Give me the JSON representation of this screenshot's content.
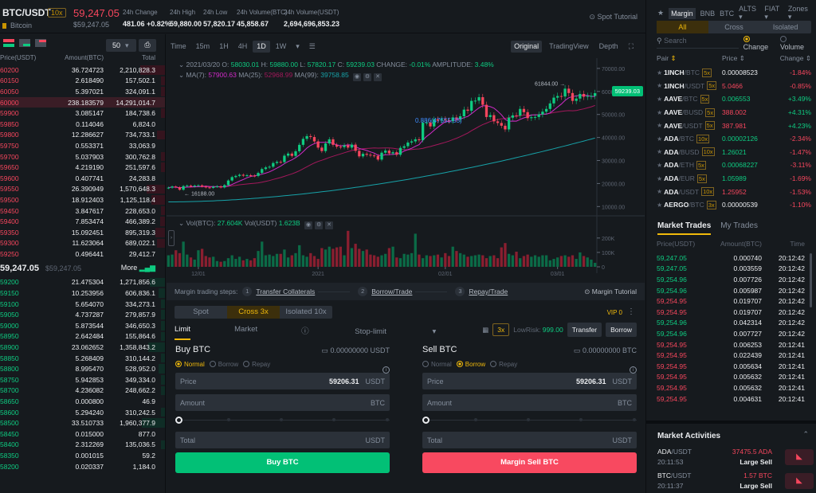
{
  "header": {
    "pair": "BTC/USDT",
    "leverage": "10x",
    "coin_name": "Bitcoin",
    "last_price": "59,247.05",
    "last_price_usd": "$59,247.05",
    "stats": [
      {
        "label": "24h Change",
        "value": "481.06 +0.82%",
        "color": "green"
      },
      {
        "label": "24h High",
        "value": "59,880.00"
      },
      {
        "label": "24h Low",
        "value": "57,820.17"
      },
      {
        "label": "24h Volume(BTC)",
        "value": "45,858.67"
      },
      {
        "label": "24h Volume(USDT)",
        "value": "2,694,696,853.23"
      }
    ],
    "spot_tutorial": "Spot Tutorial"
  },
  "orderbook": {
    "depth_select": "50",
    "columns": [
      "Price(USDT)",
      "Amount(BTC)",
      "Total"
    ],
    "asks": [
      {
        "price": "60200",
        "amount": "36.724723",
        "total": "2,210,828.3",
        "depth": 0.15
      },
      {
        "price": "60150",
        "amount": "2.618490",
        "total": "157,502.1",
        "depth": 0.01
      },
      {
        "price": "60050",
        "amount": "5.397021",
        "total": "324,091.1",
        "depth": 0.02
      },
      {
        "price": "60000",
        "amount": "238.183579",
        "total": "14,291,014.7",
        "depth": 1.0,
        "highlight": true
      },
      {
        "price": "59900",
        "amount": "3.085147",
        "total": "184,738.6",
        "depth": 0.01
      },
      {
        "price": "59850",
        "amount": "0.114046",
        "total": "6,824.0",
        "depth": 0.0
      },
      {
        "price": "59800",
        "amount": "12.286627",
        "total": "734,733.1",
        "depth": 0.05
      },
      {
        "price": "59750",
        "amount": "0.553371",
        "total": "33,063.9",
        "depth": 0.0
      },
      {
        "price": "59700",
        "amount": "5.037903",
        "total": "300,762.8",
        "depth": 0.02
      },
      {
        "price": "59650",
        "amount": "4.219190",
        "total": "251,597.6",
        "depth": 0.02
      },
      {
        "price": "59600",
        "amount": "0.407741",
        "total": "24,283.8",
        "depth": 0.0
      },
      {
        "price": "59550",
        "amount": "26.390949",
        "total": "1,570,648.3",
        "depth": 0.11
      },
      {
        "price": "59500",
        "amount": "18.912403",
        "total": "1,125,118.4",
        "depth": 0.08
      },
      {
        "price": "59450",
        "amount": "3.847617",
        "total": "228,653.0",
        "depth": 0.02
      },
      {
        "price": "59400",
        "amount": "7.853474",
        "total": "466,389.2",
        "depth": 0.03
      },
      {
        "price": "59350",
        "amount": "15.092451",
        "total": "895,319.3",
        "depth": 0.06
      },
      {
        "price": "59300",
        "amount": "11.623064",
        "total": "689,022.1",
        "depth": 0.05
      },
      {
        "price": "59250",
        "amount": "0.496441",
        "total": "29,412.7",
        "depth": 0.0
      }
    ],
    "mid_price": "59,247.05",
    "mid_price_usd": "$59,247.05",
    "more_label": "More",
    "bids": [
      {
        "price": "59200",
        "amount": "21.475304",
        "total": "1,271,856.6",
        "depth": 0.09
      },
      {
        "price": "59150",
        "amount": "10.253956",
        "total": "606,836.1",
        "depth": 0.04
      },
      {
        "price": "59100",
        "amount": "5.654070",
        "total": "334,273.1",
        "depth": 0.02
      },
      {
        "price": "59050",
        "amount": "4.737287",
        "total": "279,857.9",
        "depth": 0.02
      },
      {
        "price": "59000",
        "amount": "5.873544",
        "total": "346,650.3",
        "depth": 0.02
      },
      {
        "price": "58950",
        "amount": "2.642484",
        "total": "155,864.6",
        "depth": 0.01
      },
      {
        "price": "58900",
        "amount": "23.062652",
        "total": "1,358,843.2",
        "depth": 0.1
      },
      {
        "price": "58850",
        "amount": "5.268409",
        "total": "310,144.2",
        "depth": 0.02
      },
      {
        "price": "58800",
        "amount": "8.995470",
        "total": "528,952.0",
        "depth": 0.04
      },
      {
        "price": "58750",
        "amount": "5.942853",
        "total": "349,334.0",
        "depth": 0.02
      },
      {
        "price": "58700",
        "amount": "4.236082",
        "total": "248,662.2",
        "depth": 0.02
      },
      {
        "price": "58650",
        "amount": "0.000800",
        "total": "46.9",
        "depth": 0.0
      },
      {
        "price": "58600",
        "amount": "5.294240",
        "total": "310,242.5",
        "depth": 0.02
      },
      {
        "price": "58500",
        "amount": "33.510733",
        "total": "1,960,377.9",
        "depth": 0.14
      },
      {
        "price": "58450",
        "amount": "0.015000",
        "total": "877.0",
        "depth": 0.0
      },
      {
        "price": "58400",
        "amount": "2.312269",
        "total": "135,036.5",
        "depth": 0.01
      },
      {
        "price": "58350",
        "amount": "0.001015",
        "total": "59.2",
        "depth": 0.0
      },
      {
        "price": "58200",
        "amount": "0.020337",
        "total": "1,184.0",
        "depth": 0.0
      }
    ]
  },
  "chart": {
    "intervals": [
      "Time",
      "15m",
      "1H",
      "4H",
      "1D",
      "1W"
    ],
    "active_interval": "1D",
    "views": [
      "Original",
      "TradingView",
      "Depth"
    ],
    "active_view": "Original",
    "ohlc": {
      "date": "2021/03/20",
      "o_label": "O:",
      "o": "58030.01",
      "h_label": "H:",
      "h": "59880.00",
      "l_label": "L:",
      "l": "57820.17",
      "c_label": "C:",
      "c": "59239.03",
      "change_label": "CHANGE:",
      "change": "-0.01%",
      "amp_label": "AMPLITUDE:",
      "amp": "3.48%"
    },
    "ma": {
      "ma7_label": "MA(7):",
      "ma7": "57900.63",
      "ma25_label": "MA(25):",
      "ma25": "52968.99",
      "ma99_label": "MA(99):",
      "ma99": "39758.85"
    },
    "vol": {
      "btc_label": "Vol(BTC):",
      "btc": "27.604K",
      "usdt_label": "Vol(USDT)",
      "usdt": "1.623B"
    },
    "current_price_tag": "59239.03",
    "high_marker": "61844.00",
    "low_marker": "16188.00",
    "fib_label": "0.886(47555.55)",
    "colors": {
      "up": "#0ecb81",
      "down": "#f6465d",
      "ma7": "#d12ac8",
      "ma25": "#a3185b",
      "ma99": "#17a2a8"
    }
  },
  "chart_data": {
    "type": "candlestick",
    "title": "BTC/USDT 1D",
    "x_tick_labels": [
      "12/01",
      "2021",
      "02/01",
      "03/01"
    ],
    "y_ticks": [
      10000,
      20000,
      30000,
      40000,
      50000,
      60000,
      70000
    ],
    "y_tick_labels": [
      "10000.00",
      "20000.00",
      "30000.00",
      "40000.00",
      "50000.00",
      "60000.00",
      "70000.00"
    ],
    "ylim": [
      7000,
      71000
    ],
    "vol_ticks": [
      0,
      100000,
      200000
    ],
    "vol_tick_labels": [
      "0",
      "100K",
      "200K"
    ],
    "vol_ylim": [
      0,
      260000
    ],
    "close_series": [
      18200,
      18700,
      18400,
      17300,
      18900,
      19100,
      18700,
      19100,
      19200,
      18700,
      18300,
      18100,
      18600,
      18800,
      18300,
      19300,
      21300,
      22800,
      23300,
      23800,
      23400,
      23600,
      23400,
      23300,
      24600,
      26300,
      27000,
      27300,
      28900,
      29400,
      29300,
      32100,
      33000,
      32000,
      34000,
      36800,
      39400,
      40600,
      40200,
      38300,
      35600,
      34100,
      37400,
      39200,
      36800,
      36000,
      35800,
      36600,
      35600,
      36900,
      34200,
      31800,
      32900,
      32500,
      32200,
      32000,
      30400,
      33400,
      34300,
      33100,
      33600,
      32500,
      35500,
      36200,
      37800,
      38300,
      39200,
      38800,
      46400,
      46500,
      44800,
      47900,
      47300,
      48000,
      47400,
      47100,
      48700,
      47900,
      49200,
      52100,
      51600,
      55900,
      56000,
      57500,
      54200,
      48900,
      49700,
      47000,
      46300,
      45100,
      43500,
      48600,
      49600,
      49500,
      52400,
      51000,
      48400,
      48800,
      48900,
      50000,
      51200,
      52400,
      54800,
      57300,
      58000,
      57800,
      61200,
      59300,
      55900,
      56900,
      58900,
      57700,
      58000,
      58100,
      59239
    ],
    "open_series": [
      18000,
      18200,
      18700,
      18400,
      17300,
      18900,
      19100,
      18700,
      19100,
      19200,
      18700,
      18300,
      18100,
      18600,
      18800,
      18300,
      19300,
      21300,
      22800,
      23300,
      23800,
      23400,
      23600,
      23400,
      23300,
      24600,
      26300,
      27000,
      27300,
      28900,
      29400,
      29300,
      32100,
      33000,
      32000,
      34000,
      36800,
      39400,
      40600,
      40200,
      38300,
      35600,
      34100,
      37400,
      39200,
      36800,
      36000,
      35800,
      36600,
      35600,
      36900,
      34200,
      31800,
      32900,
      32500,
      32200,
      32000,
      30400,
      33400,
      34300,
      33100,
      33600,
      32500,
      35500,
      36200,
      37800,
      38300,
      39200,
      38800,
      46400,
      46500,
      44800,
      47900,
      47300,
      48000,
      47400,
      47100,
      48700,
      47900,
      49200,
      52100,
      51600,
      55900,
      56000,
      57500,
      54200,
      48900,
      49700,
      47000,
      46300,
      45100,
      43500,
      48600,
      49600,
      49500,
      52400,
      51000,
      48400,
      48800,
      48900,
      50000,
      51200,
      52400,
      54800,
      57300,
      58000,
      57800,
      61200,
      59300,
      55900,
      56900,
      58900,
      57700,
      58000,
      58030
    ],
    "volume_series": [
      80000,
      85000,
      115000,
      95000,
      175000,
      85000,
      65000,
      50000,
      115000,
      125000,
      75000,
      65000,
      70000,
      40000,
      35000,
      40000,
      60000,
      80000,
      55000,
      70000,
      45000,
      55000,
      45000,
      60000,
      110000,
      175000,
      80000,
      85000,
      75000,
      90000,
      90000,
      120000,
      65000,
      80000,
      95000,
      150000,
      80000,
      70000,
      95000,
      75000,
      55000,
      130000,
      120000,
      140000,
      125000,
      135000,
      140000,
      80000,
      250000,
      130000,
      160000,
      125000,
      110000,
      120000,
      85000,
      80000,
      70000,
      80000,
      90000,
      130000,
      140000,
      65000,
      60000,
      90000,
      85000,
      95000,
      230000,
      85000,
      60000,
      80000,
      75000,
      80000,
      85000,
      65000,
      95000,
      75000,
      140000,
      110000,
      95000,
      85000,
      70000,
      75000,
      80000,
      85000,
      80000,
      60000,
      75000,
      80000,
      60000,
      135000,
      165000,
      90000,
      80000,
      105000,
      60000,
      75000,
      85000,
      70000,
      80000,
      70000,
      80000,
      80000,
      45000,
      55000,
      65000,
      75000,
      80000,
      70000,
      80000,
      55000,
      100000,
      75000,
      65000,
      50000,
      27604
    ],
    "ma7_note": "MA(7) 57900.63",
    "ma25_note": "MA(25) 52968.99",
    "ma99_note": "MA(99) 39758.85"
  },
  "steps": {
    "label": "Margin trading steps:",
    "items": [
      {
        "num": "1",
        "label": "Transfer Collaterals"
      },
      {
        "num": "2",
        "label": "Borrow/Trade"
      },
      {
        "num": "3",
        "label": "Repay/Trade"
      }
    ],
    "tutorial": "Margin Tutorial"
  },
  "trade": {
    "modes": [
      "Spot",
      "Cross 3x",
      "Isolated 10x"
    ],
    "active_mode": "Cross 3x",
    "vip": "VIP 0",
    "order_types": [
      "Limit",
      "Market",
      "Stop-limit"
    ],
    "leverage": "3x",
    "low_risk_label": "LowRisk:",
    "low_risk_value": "999.00",
    "transfer": "Transfer",
    "borrow": "Borrow",
    "buy": {
      "title": "Buy BTC",
      "balance": "0.00000000 USDT",
      "options": [
        "Normal",
        "Borrow",
        "Repay"
      ],
      "selected": "Normal",
      "price_label": "Price",
      "price_value": "59206.31",
      "price_unit": "USDT",
      "amount_label": "Amount",
      "amount_unit": "BTC",
      "slider_percent": 0,
      "total_label": "Total",
      "total_unit": "USDT",
      "button": "Buy BTC"
    },
    "sell": {
      "title": "Sell BTC",
      "balance": "0.00000000 BTC",
      "options": [
        "Normal",
        "Borrow",
        "Repay"
      ],
      "selected": "Borrow",
      "price_label": "Price",
      "price_value": "59206.31",
      "price_unit": "USDT",
      "amount_label": "Amount",
      "amount_unit": "BTC",
      "slider_percent": 0,
      "total_label": "Total",
      "total_unit": "USDT",
      "button": "Margin Sell BTC"
    }
  },
  "markets": {
    "tabs": [
      "Margin",
      "BNB",
      "BTC",
      "ALTS ▾",
      "FIAT ▾",
      "Zones ▾"
    ],
    "active_tab": "Margin",
    "segments": [
      "All",
      "Cross",
      "Isolated"
    ],
    "active_segment": "All",
    "search_placeholder": "Search",
    "sort_options": [
      "Change",
      "Volume"
    ],
    "selected_sort": "Change",
    "columns": [
      "Pair",
      "Price",
      "Change"
    ],
    "pairs": [
      {
        "base": "1INCH",
        "quote": "/BTC",
        "lev": "5x",
        "price": "0.00008523",
        "price_color": "neutral",
        "change": "-1.84%"
      },
      {
        "base": "1INCH",
        "quote": "/USDT",
        "lev": "5x",
        "price": "5.0466",
        "price_color": "red",
        "change": "-0.85%"
      },
      {
        "base": "AAVE",
        "quote": "/BTC",
        "lev": "5x",
        "price": "0.006553",
        "price_color": "green",
        "change": "+3.49%"
      },
      {
        "base": "AAVE",
        "quote": "/BUSD",
        "lev": "5x",
        "price": "388.002",
        "price_color": "red",
        "change": "+4.31%"
      },
      {
        "base": "AAVE",
        "quote": "/USDT",
        "lev": "5x",
        "price": "387.981",
        "price_color": "red",
        "change": "+4.23%"
      },
      {
        "base": "ADA",
        "quote": "/BTC",
        "lev": "10x",
        "price": "0.00002126",
        "price_color": "green",
        "change": "-2.34%"
      },
      {
        "base": "ADA",
        "quote": "/BUSD",
        "lev": "10x",
        "price": "1.26021",
        "price_color": "green",
        "change": "-1.47%"
      },
      {
        "base": "ADA",
        "quote": "/ETH",
        "lev": "5x",
        "price": "0.00068227",
        "price_color": "green",
        "change": "-3.11%"
      },
      {
        "base": "ADA",
        "quote": "/EUR",
        "lev": "5x",
        "price": "1.05989",
        "price_color": "green",
        "change": "-1.69%"
      },
      {
        "base": "ADA",
        "quote": "/USDT",
        "lev": "10x",
        "price": "1.25952",
        "price_color": "red",
        "change": "-1.53%"
      },
      {
        "base": "AERGO",
        "quote": "/BTC",
        "lev": "3x",
        "price": "0.00000539",
        "price_color": "neutral",
        "change": "-1.10%"
      }
    ]
  },
  "trades": {
    "tabs": [
      "Market Trades",
      "My Trades"
    ],
    "columns": [
      "Price(USDT)",
      "Amount(BTC)",
      "Time"
    ],
    "rows": [
      {
        "price": "59,247.05",
        "amount": "0.000740",
        "time": "20:12:42",
        "side": "buy"
      },
      {
        "price": "59,247.05",
        "amount": "0.003559",
        "time": "20:12:42",
        "side": "buy"
      },
      {
        "price": "59,254.96",
        "amount": "0.007726",
        "time": "20:12:42",
        "side": "buy"
      },
      {
        "price": "59,254.96",
        "amount": "0.005987",
        "time": "20:12:42",
        "side": "buy"
      },
      {
        "price": "59,254.95",
        "amount": "0.019707",
        "time": "20:12:42",
        "side": "sell"
      },
      {
        "price": "59,254.95",
        "amount": "0.019707",
        "time": "20:12:42",
        "side": "sell"
      },
      {
        "price": "59,254.96",
        "amount": "0.042314",
        "time": "20:12:42",
        "side": "buy"
      },
      {
        "price": "59,254.96",
        "amount": "0.007727",
        "time": "20:12:42",
        "side": "buy"
      },
      {
        "price": "59,254.95",
        "amount": "0.006253",
        "time": "20:12:41",
        "side": "sell"
      },
      {
        "price": "59,254.95",
        "amount": "0.022439",
        "time": "20:12:41",
        "side": "sell"
      },
      {
        "price": "59,254.95",
        "amount": "0.005634",
        "time": "20:12:41",
        "side": "sell"
      },
      {
        "price": "59,254.95",
        "amount": "0.005632",
        "time": "20:12:41",
        "side": "sell"
      },
      {
        "price": "59,254.95",
        "amount": "0.005632",
        "time": "20:12:41",
        "side": "sell"
      },
      {
        "price": "59,254.95",
        "amount": "0.004631",
        "time": "20:12:41",
        "side": "sell"
      }
    ]
  },
  "activities": {
    "title": "Market Activities",
    "items": [
      {
        "base": "ADA",
        "quote": "/USDT",
        "time": "20:11:53",
        "qty": "37475.5 ADA",
        "kind": "Large Sell"
      },
      {
        "base": "BTC",
        "quote": "/USDT",
        "time": "20:11:37",
        "qty": "1.57 BTC",
        "kind": "Large Sell"
      }
    ]
  }
}
